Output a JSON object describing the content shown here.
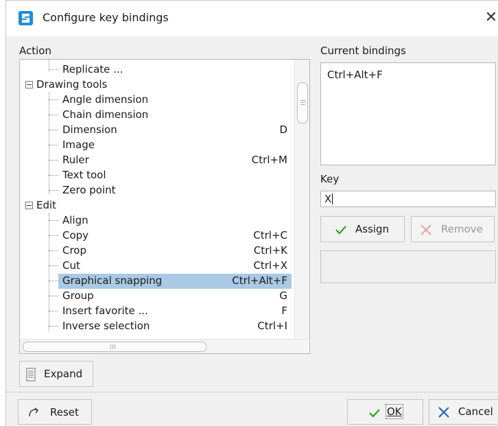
{
  "window": {
    "title": "Configure key bindings",
    "close_icon": "close-icon"
  },
  "action_panel": {
    "label": "Action",
    "rows": [
      {
        "label": "Replicate ...",
        "shortcut": ""
      },
      {
        "label": "Drawing tools",
        "shortcut": "",
        "group": true,
        "expanded": true
      },
      {
        "label": "Angle dimension",
        "shortcut": ""
      },
      {
        "label": "Chain dimension",
        "shortcut": ""
      },
      {
        "label": "Dimension",
        "shortcut": "D"
      },
      {
        "label": "Image",
        "shortcut": ""
      },
      {
        "label": "Ruler",
        "shortcut": "Ctrl+M"
      },
      {
        "label": "Text tool",
        "shortcut": ""
      },
      {
        "label": "Zero point",
        "shortcut": ""
      },
      {
        "label": "Edit",
        "shortcut": "",
        "group": true,
        "expanded": true
      },
      {
        "label": "Align",
        "shortcut": ""
      },
      {
        "label": "Copy",
        "shortcut": "Ctrl+C"
      },
      {
        "label": "Crop",
        "shortcut": "Ctrl+K"
      },
      {
        "label": "Cut",
        "shortcut": "Ctrl+X"
      },
      {
        "label": "Graphical snapping",
        "shortcut": "Ctrl+Alt+F",
        "selected": true
      },
      {
        "label": "Group",
        "shortcut": "G"
      },
      {
        "label": "Insert favorite ...",
        "shortcut": "F"
      },
      {
        "label": "Inverse selection",
        "shortcut": "Ctrl+I"
      }
    ],
    "expand_button": "Expand"
  },
  "bindings_panel": {
    "label": "Current bindings",
    "items": [
      "Ctrl+Alt+F"
    ],
    "key_label": "Key",
    "key_value": "X",
    "assign_button": "Assign",
    "remove_button": "Remove"
  },
  "footer": {
    "reset_button": "Reset",
    "ok_button": "OK",
    "cancel_button": "Cancel"
  },
  "colors": {
    "selection": "#a9c9e4",
    "assign_check": "#3a9a2a",
    "remove_x": "#e7a3a3",
    "cancel_x": "#1f5fbf",
    "app_icon": "#1e8fd6"
  }
}
